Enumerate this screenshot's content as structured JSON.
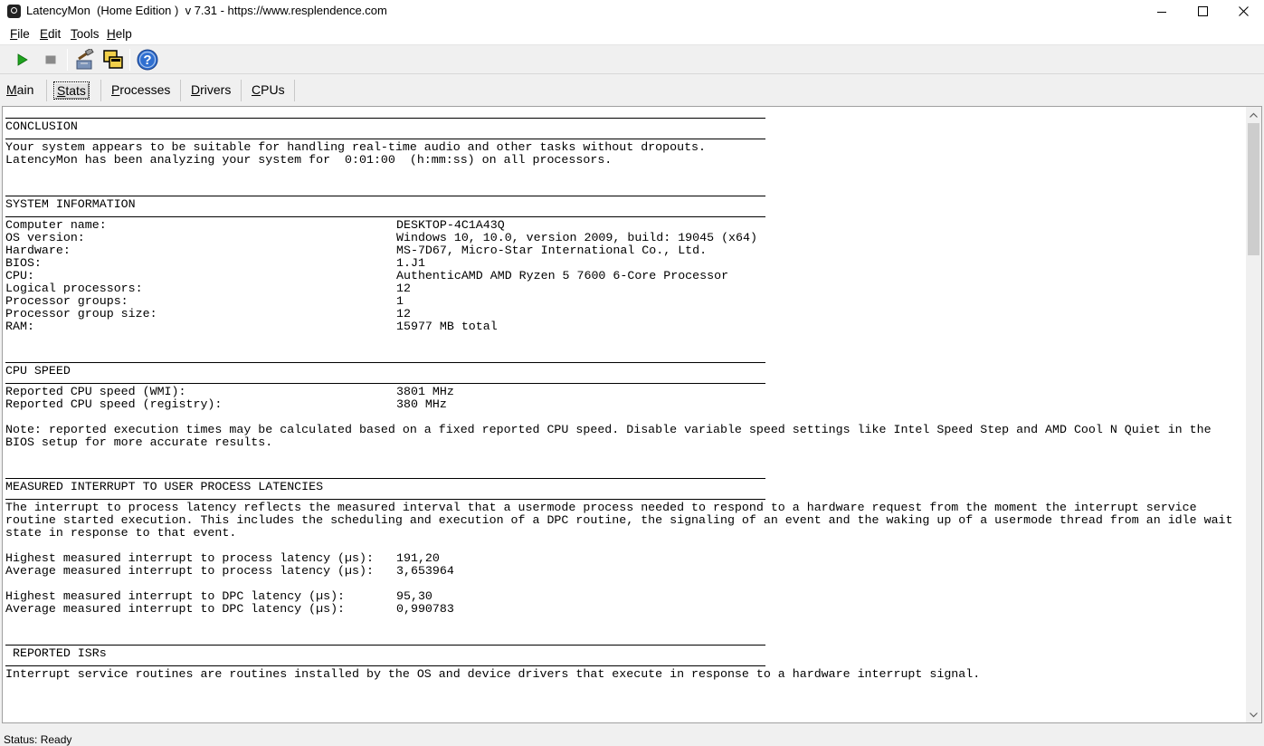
{
  "window": {
    "title": "LatencyMon  (Home Edition )  v 7.31 - https://www.resplendence.com"
  },
  "menu": [
    {
      "u": "F",
      "rest": "ile"
    },
    {
      "u": "E",
      "rest": "dit"
    },
    {
      "u": "T",
      "rest": "ools"
    },
    {
      "u": "H",
      "rest": "elp"
    }
  ],
  "toolbar": {
    "start_icon": "play-icon",
    "stop_icon": "stop-icon",
    "drivers_icon": "tools-icon",
    "cpu_icon": "windows-icon",
    "help_icon": "help-icon"
  },
  "tabs": [
    {
      "u": "M",
      "rest": "ain"
    },
    {
      "u": "S",
      "rest": "tats"
    },
    {
      "u": "P",
      "rest": "rocesses"
    },
    {
      "u": "D",
      "rest": "rivers"
    },
    {
      "u": "C",
      "rest": "PUs"
    }
  ],
  "report": {
    "conclusion": {
      "title": "CONCLUSION",
      "line1": "Your system appears to be suitable for handling real-time audio and other tasks without dropouts.",
      "line2": "LatencyMon has been analyzing your system for  0:01:00  (h:mm:ss) on all processors."
    },
    "system_info": {
      "title": "SYSTEM INFORMATION",
      "rows": [
        {
          "k": "Computer name:",
          "v": "DESKTOP-4C1A43Q"
        },
        {
          "k": "OS version:",
          "v": "Windows 10, 10.0, version 2009, build: 19045 (x64)"
        },
        {
          "k": "Hardware:",
          "v": "MS-7D67, Micro-Star International Co., Ltd."
        },
        {
          "k": "BIOS:",
          "v": "1.J1"
        },
        {
          "k": "CPU:",
          "v": "AuthenticAMD AMD Ryzen 5 7600 6-Core Processor"
        },
        {
          "k": "Logical processors:",
          "v": "12"
        },
        {
          "k": "Processor groups:",
          "v": "1"
        },
        {
          "k": "Processor group size:",
          "v": "12"
        },
        {
          "k": "RAM:",
          "v": "15977 MB total"
        }
      ]
    },
    "cpu_speed": {
      "title": "CPU SPEED",
      "rows": [
        {
          "k": "Reported CPU speed (WMI):",
          "v": "3801 MHz"
        },
        {
          "k": "Reported CPU speed (registry):",
          "v": "380 MHz"
        }
      ],
      "note": "Note: reported execution times may be calculated based on a fixed reported CPU speed. Disable variable speed settings like Intel Speed Step and AMD Cool N Quiet in the BIOS setup for more accurate results."
    },
    "latencies": {
      "title": "MEASURED INTERRUPT TO USER PROCESS LATENCIES",
      "desc": "The interrupt to process latency reflects the measured interval that a usermode process needed to respond to a hardware request from the moment the interrupt service routine started execution. This includes the scheduling and execution of a DPC routine, the signaling of an event and the waking up of a usermode thread from an idle wait state in response to that event.",
      "rows1": [
        {
          "k": "Highest measured interrupt to process latency (µs):",
          "v": "191,20"
        },
        {
          "k": "Average measured interrupt to process latency (µs):",
          "v": "3,653964"
        }
      ],
      "rows2": [
        {
          "k": "Highest measured interrupt to DPC latency (µs):",
          "v": "95,30"
        },
        {
          "k": "Average measured interrupt to DPC latency (µs):",
          "v": "0,990783"
        }
      ]
    },
    "isrs": {
      "title": " REPORTED ISRs",
      "desc": "Interrupt service routines are routines installed by the OS and device drivers that execute in response to a hardware interrupt signal."
    }
  },
  "status": {
    "text": "Status: Ready"
  }
}
